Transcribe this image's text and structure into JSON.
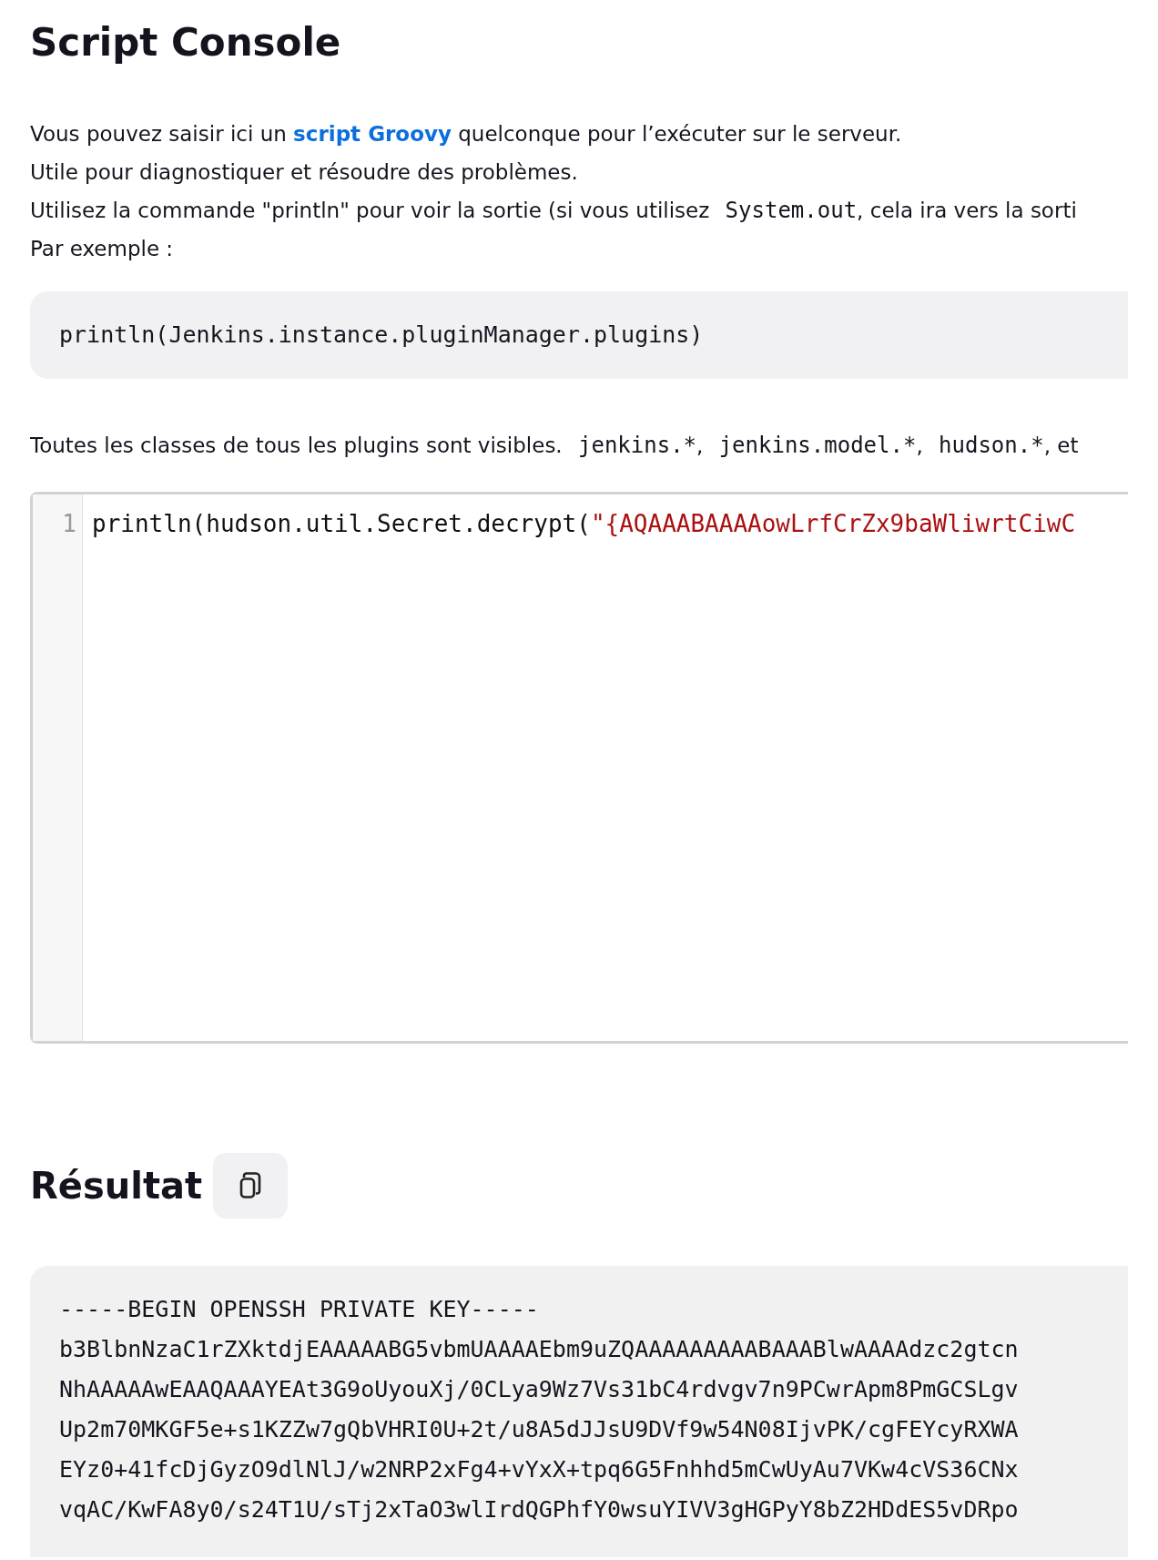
{
  "title": "Script Console",
  "intro": [
    [
      {
        "kind": "text",
        "text": "Vous pouvez saisir ici un "
      },
      {
        "kind": "link",
        "text": "script Groovy"
      },
      {
        "kind": "text",
        "text": " quelconque pour l’exécuter sur le serveur."
      }
    ],
    [
      {
        "kind": "text",
        "text": "Utile pour diagnostiquer et résoudre des problèmes."
      }
    ],
    [
      {
        "kind": "text",
        "text": "Utilisez la commande \"println\" pour voir la sortie (si vous utilisez "
      },
      {
        "kind": "code",
        "text": "System.out"
      },
      {
        "kind": "text",
        "text": ", cela ira vers la sorti"
      }
    ],
    [
      {
        "kind": "text",
        "text": "Par exemple :"
      }
    ]
  ],
  "example_code": "println(Jenkins.instance.pluginManager.plugins)",
  "classes_note": [
    {
      "kind": "text",
      "text": "Toutes les classes de tous les plugins sont visibles. "
    },
    {
      "kind": "code",
      "text": "jenkins.*"
    },
    {
      "kind": "text",
      "text": ", "
    },
    {
      "kind": "code",
      "text": "jenkins.model.*"
    },
    {
      "kind": "text",
      "text": ", "
    },
    {
      "kind": "code",
      "text": "hudson.*"
    },
    {
      "kind": "text",
      "text": ", et"
    }
  ],
  "editor": {
    "lines": [
      {
        "number": "1",
        "tokens": [
          {
            "kind": "plain",
            "text": "println(hudson.util.Secret.decrypt("
          },
          {
            "kind": "string",
            "text": "\"{AQAAABAAAAowLrfCrZx9baWliwrtCiwC"
          }
        ]
      }
    ]
  },
  "result": {
    "heading": "Résultat",
    "lines": [
      "-----BEGIN OPENSSH PRIVATE KEY-----",
      "b3BlbnNzaC1rZXktdjEAAAAABG5vbmUAAAAEbm9uZQAAAAAAAAABAAABlwAAAAdzc2gtcn",
      "NhAAAAAwEAAQAAAYEAt3G9oUyouXj/0CLya9Wz7Vs31bC4rdvgv7n9PCwrApm8PmGCSLgv",
      "Up2m70MKGF5e+s1KZZw7gQbVHRI0U+2t/u8A5dJJsU9DVf9w54N08IjvPK/cgFEYcyRXWA",
      "EYz0+41fcDjGyzO9dlNlJ/w2NRP2xFg4+vYxX+tpq6G5Fnhhd5mCwUyAu7VKw4cVS36CNx",
      "vqAC/KwFA8y0/s24T1U/sTj2xTaO3wlIrdQGPhfY0wsuYIVV3gHGPyY8bZ2HDdES5vDRpo"
    ]
  }
}
